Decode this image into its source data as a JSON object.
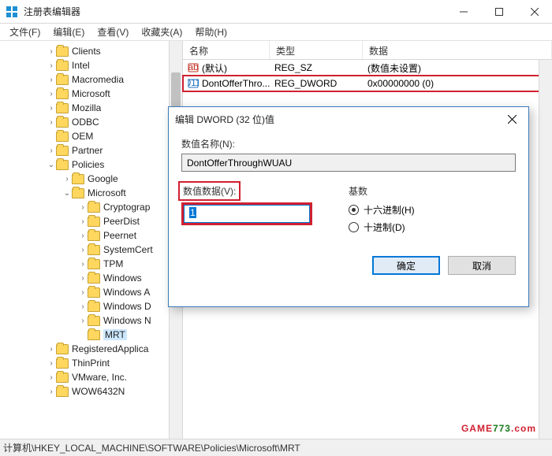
{
  "window": {
    "title": "注册表编辑器"
  },
  "menu": {
    "file": "文件(F)",
    "edit": "编辑(E)",
    "view": "查看(V)",
    "favorites": "收藏夹(A)",
    "help": "帮助(H)"
  },
  "tree": {
    "items": [
      {
        "indent": 55,
        "expander": "›",
        "label": "Clients"
      },
      {
        "indent": 55,
        "expander": "›",
        "label": "Intel"
      },
      {
        "indent": 55,
        "expander": "›",
        "label": "Macromedia"
      },
      {
        "indent": 55,
        "expander": "›",
        "label": "Microsoft"
      },
      {
        "indent": 55,
        "expander": "›",
        "label": "Mozilla"
      },
      {
        "indent": 55,
        "expander": "›",
        "label": "ODBC"
      },
      {
        "indent": 55,
        "expander": "",
        "label": "OEM"
      },
      {
        "indent": 55,
        "expander": "›",
        "label": "Partner"
      },
      {
        "indent": 55,
        "expander": "⌄",
        "label": "Policies"
      },
      {
        "indent": 75,
        "expander": "›",
        "label": "Google"
      },
      {
        "indent": 75,
        "expander": "⌄",
        "label": "Microsoft"
      },
      {
        "indent": 95,
        "expander": "›",
        "label": "Cryptograp"
      },
      {
        "indent": 95,
        "expander": "›",
        "label": "PeerDist"
      },
      {
        "indent": 95,
        "expander": "›",
        "label": "Peernet"
      },
      {
        "indent": 95,
        "expander": "›",
        "label": "SystemCert"
      },
      {
        "indent": 95,
        "expander": "›",
        "label": "TPM"
      },
      {
        "indent": 95,
        "expander": "›",
        "label": "Windows"
      },
      {
        "indent": 95,
        "expander": "›",
        "label": "Windows A"
      },
      {
        "indent": 95,
        "expander": "›",
        "label": "Windows D"
      },
      {
        "indent": 95,
        "expander": "›",
        "label": "Windows N"
      },
      {
        "indent": 95,
        "expander": "",
        "label": "MRT",
        "selected": true
      },
      {
        "indent": 55,
        "expander": "›",
        "label": "RegisteredApplica"
      },
      {
        "indent": 55,
        "expander": "›",
        "label": "ThinPrint"
      },
      {
        "indent": 55,
        "expander": "›",
        "label": "VMware, Inc."
      },
      {
        "indent": 55,
        "expander": "›",
        "label": "WOW6432N"
      }
    ]
  },
  "list": {
    "columns": {
      "name": "名称",
      "type": "类型",
      "data": "数据"
    },
    "rows": [
      {
        "icon": "string",
        "name": "(默认)",
        "type": "REG_SZ",
        "data": "(数值未设置)"
      },
      {
        "icon": "dword",
        "name": "DontOfferThro...",
        "type": "REG_DWORD",
        "data": "0x00000000 (0)",
        "highlighted": true
      }
    ]
  },
  "dialog": {
    "title": "编辑 DWORD (32 位)值",
    "name_label": "数值名称(N):",
    "name_value": "DontOfferThroughWUAU",
    "value_label": "数值数据(V):",
    "value_input": "1",
    "base_label": "基数",
    "radio_hex": "十六进制(H)",
    "radio_dec": "十进制(D)",
    "ok": "确定",
    "cancel": "取消"
  },
  "statusbar": {
    "path": "计算机\\HKEY_LOCAL_MACHINE\\SOFTWARE\\Policies\\Microsoft\\MRT"
  },
  "watermark": {
    "brand": "GAME773",
    "suffix": ".com"
  }
}
